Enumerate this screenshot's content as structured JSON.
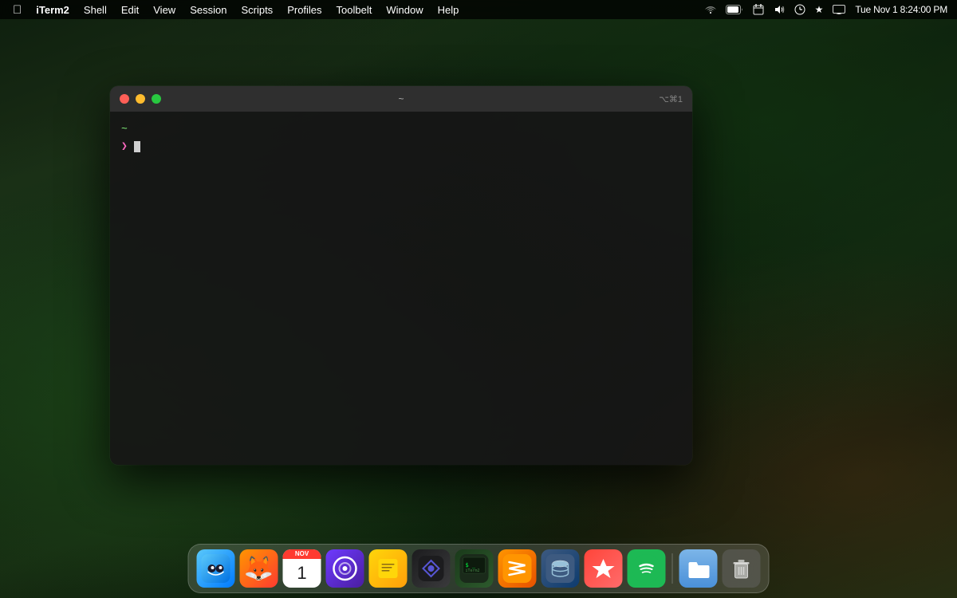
{
  "menubar": {
    "apple_label": "",
    "app_name": "iTerm2",
    "items": [
      {
        "label": "Shell",
        "id": "shell"
      },
      {
        "label": "Edit",
        "id": "edit"
      },
      {
        "label": "View",
        "id": "view"
      },
      {
        "label": "Session",
        "id": "session"
      },
      {
        "label": "Scripts",
        "id": "scripts"
      },
      {
        "label": "Profiles",
        "id": "profiles"
      },
      {
        "label": "Toolbelt",
        "id": "toolbelt"
      },
      {
        "label": "Window",
        "id": "window"
      },
      {
        "label": "Help",
        "id": "help"
      }
    ],
    "status_right": {
      "datetime": "Tue Nov 1  8:24:00 PM",
      "battery": "▮▮▮▮",
      "wifi": "wifi"
    }
  },
  "terminal": {
    "title": "~",
    "tab_control": "⌥⌘1",
    "tilde_line": "~",
    "prompt_char": "❯",
    "cursor_visible": true
  },
  "dock": {
    "icons": [
      {
        "id": "finder",
        "label": "Finder",
        "emoji": ""
      },
      {
        "id": "firefox",
        "label": "Firefox",
        "emoji": "🦊"
      },
      {
        "id": "calendar",
        "label": "Calendar",
        "month": "NOV",
        "day": "1"
      },
      {
        "id": "omnifocus",
        "label": "OmniFocus",
        "emoji": "✓"
      },
      {
        "id": "notes",
        "label": "Notes",
        "emoji": "📝"
      },
      {
        "id": "craft",
        "label": "Craft",
        "emoji": "◆"
      },
      {
        "id": "iterm",
        "label": "iTerm2",
        "emoji": ""
      },
      {
        "id": "sublime",
        "label": "Sublime Text",
        "emoji": ""
      },
      {
        "id": "dbeaver",
        "label": "DBeaver",
        "emoji": ""
      },
      {
        "id": "fantastical",
        "label": "Fantastical",
        "emoji": ""
      },
      {
        "id": "spotify",
        "label": "Spotify",
        "emoji": ""
      },
      {
        "id": "files",
        "label": "Files",
        "emoji": "📁"
      },
      {
        "id": "trash",
        "label": "Trash",
        "emoji": "🗑️"
      }
    ]
  }
}
